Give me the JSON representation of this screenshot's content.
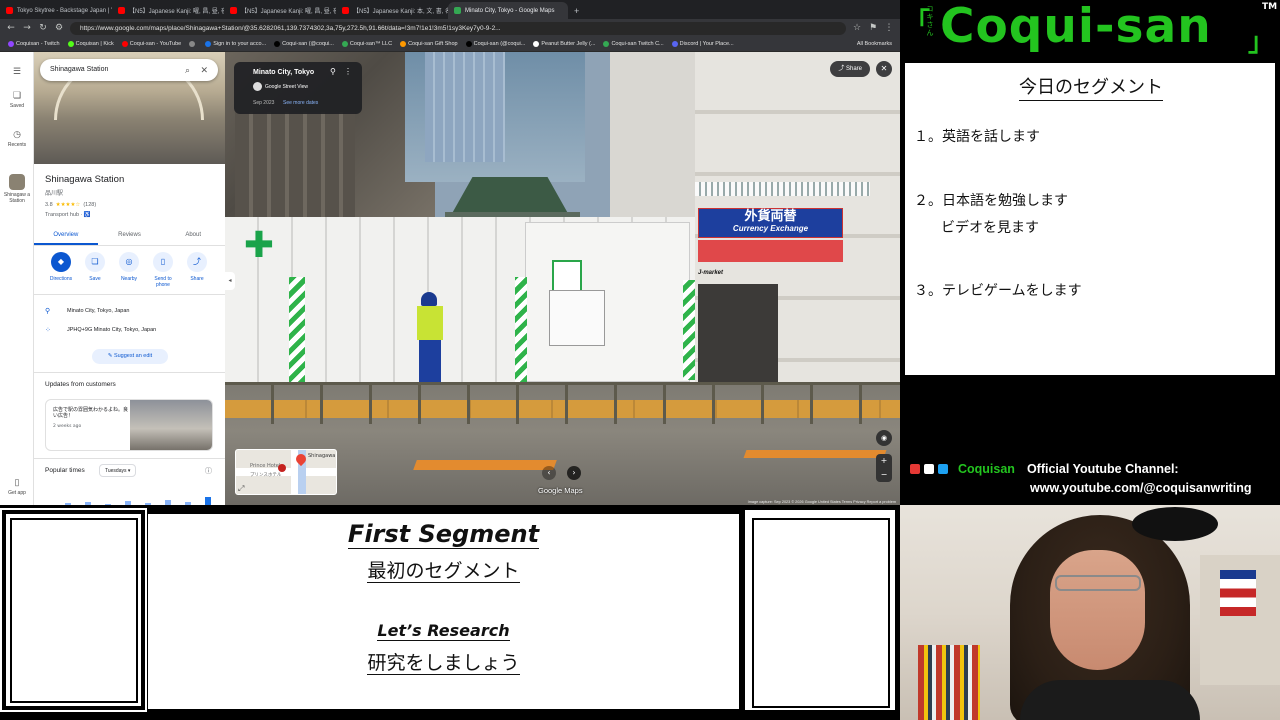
{
  "browser": {
    "tabs": [
      {
        "title": "Tokyo Skytree - Backstage Japan | Y...",
        "color": "#ff0000",
        "active": false
      },
      {
        "title": "【N5】Japanese Kanji: 曜, 昌, 昼, 夜, ...",
        "color": "#ff0000",
        "active": false
      },
      {
        "title": "【N5】Japanese Kanji: 曜, 昌, 昼, 夜, ...",
        "color": "#ff0000",
        "active": false
      },
      {
        "title": "【N5】Japanese Kanji: 本, 文, 書, 名, ...",
        "color": "#ff0000",
        "active": false
      },
      {
        "title": "Minato City, Tokyo - Google Maps",
        "color": "#34a853",
        "active": true
      }
    ],
    "new_tab": "+",
    "url": "https://www.google.com/maps/place/Shinagawa+Station/@35.6282061,139.7374302,3a,75y,272.5h,91.66t/data=!3m7!1e1!3m5!1sy3Key7y0-9-2...",
    "bookmarks": [
      {
        "label": "Coquisan - Twitch",
        "color": "#9146ff"
      },
      {
        "label": "Coquisan | Kick",
        "color": "#53fc18"
      },
      {
        "label": "Coqui-san - YouTube",
        "color": "#ff0000"
      },
      {
        "label": "",
        "color": "#888888"
      },
      {
        "label": "Sign in to your acco...",
        "color": "#1a73e8"
      },
      {
        "label": "Coqui-san (@coqui...",
        "color": "#000000"
      },
      {
        "label": "Coqui-san™ LLC",
        "color": "#34a853"
      },
      {
        "label": "Coqui-san Gift Shop",
        "color": "#ff9900"
      },
      {
        "label": "Coqui-san (@coqui...",
        "color": "#000000"
      },
      {
        "label": "Peanut Butter Jelly (...",
        "color": "#ffffff"
      },
      {
        "label": "Coqui-san Twitch C...",
        "color": "#34a853"
      },
      {
        "label": "Discord | Your Place...",
        "color": "#5865f2"
      }
    ],
    "all_bookmarks": "All Bookmarks"
  },
  "maps": {
    "rail": {
      "saved": "Saved",
      "recents": "Recents",
      "place": "Shinagaw a Station",
      "get_app": "Get app"
    },
    "search_value": "Shinagawa Station",
    "place_name": "Shinagawa Station",
    "place_name_jp": "品川駅",
    "rating": "3.8",
    "stars": "★★★★☆",
    "review_count": "(128)",
    "category": "Transport hub · ♿",
    "tabs": [
      "Overview",
      "Reviews",
      "About"
    ],
    "actions": [
      "Directions",
      "Save",
      "Nearby",
      "Send to phone",
      "Share"
    ],
    "address": "Minato City, Tokyo, Japan",
    "plus_code": "JPHQ+9G Minato City, Tokyo, Japan",
    "suggest_edit": "Suggest an edit",
    "updates_title": "Updates from customers",
    "update_text": "広告で駅の雰囲気わかるよね。良い広告！",
    "update_time": "2 weeks ago",
    "popular_times": "Popular times",
    "popular_day": "Tuesdays"
  },
  "streetview": {
    "location": "Minato City, Tokyo",
    "source": "Google Street View",
    "date": "Sep 2023",
    "see_more": "See more dates",
    "share": "Share",
    "logo": "Google Maps",
    "minimap_label": "Shinagawa",
    "minimap_hotel": "Prince Hotel",
    "minimap_hotel_jp": "プリンスホテル",
    "footer": "Image capture: Sep 2023   © 2026 Google   United States   Terms   Privacy   Report a problem",
    "sign_exchange_jp": "外貨両替",
    "sign_exchange_en": "Currency Exchange",
    "sign_jmarket": "J-market"
  },
  "overlay": {
    "logo_text": "Coqui-san",
    "logo_kana": "コキさん",
    "logo_bracket_open": "「",
    "logo_bracket_close": "」",
    "tm": "TM",
    "agenda_title": "今日のセグメント",
    "agenda_items": [
      "１。英語を話します",
      "２。日本語を勉強します",
      "ビデオを見ます",
      "３。テレビゲームをします"
    ],
    "channel_name": "Coquisan",
    "channel_label": "Official Youtube Channel:",
    "channel_url": "www.youtube.com/@coquisanwriting",
    "segment_title": "First Segment",
    "segment_title_jp": "最初のセグメント",
    "segment_label": "Let’s Research",
    "segment_label_jp": "研究をしましょう"
  },
  "colors": {
    "brand_green": "#23c41f",
    "maps_blue": "#0b57d0"
  }
}
